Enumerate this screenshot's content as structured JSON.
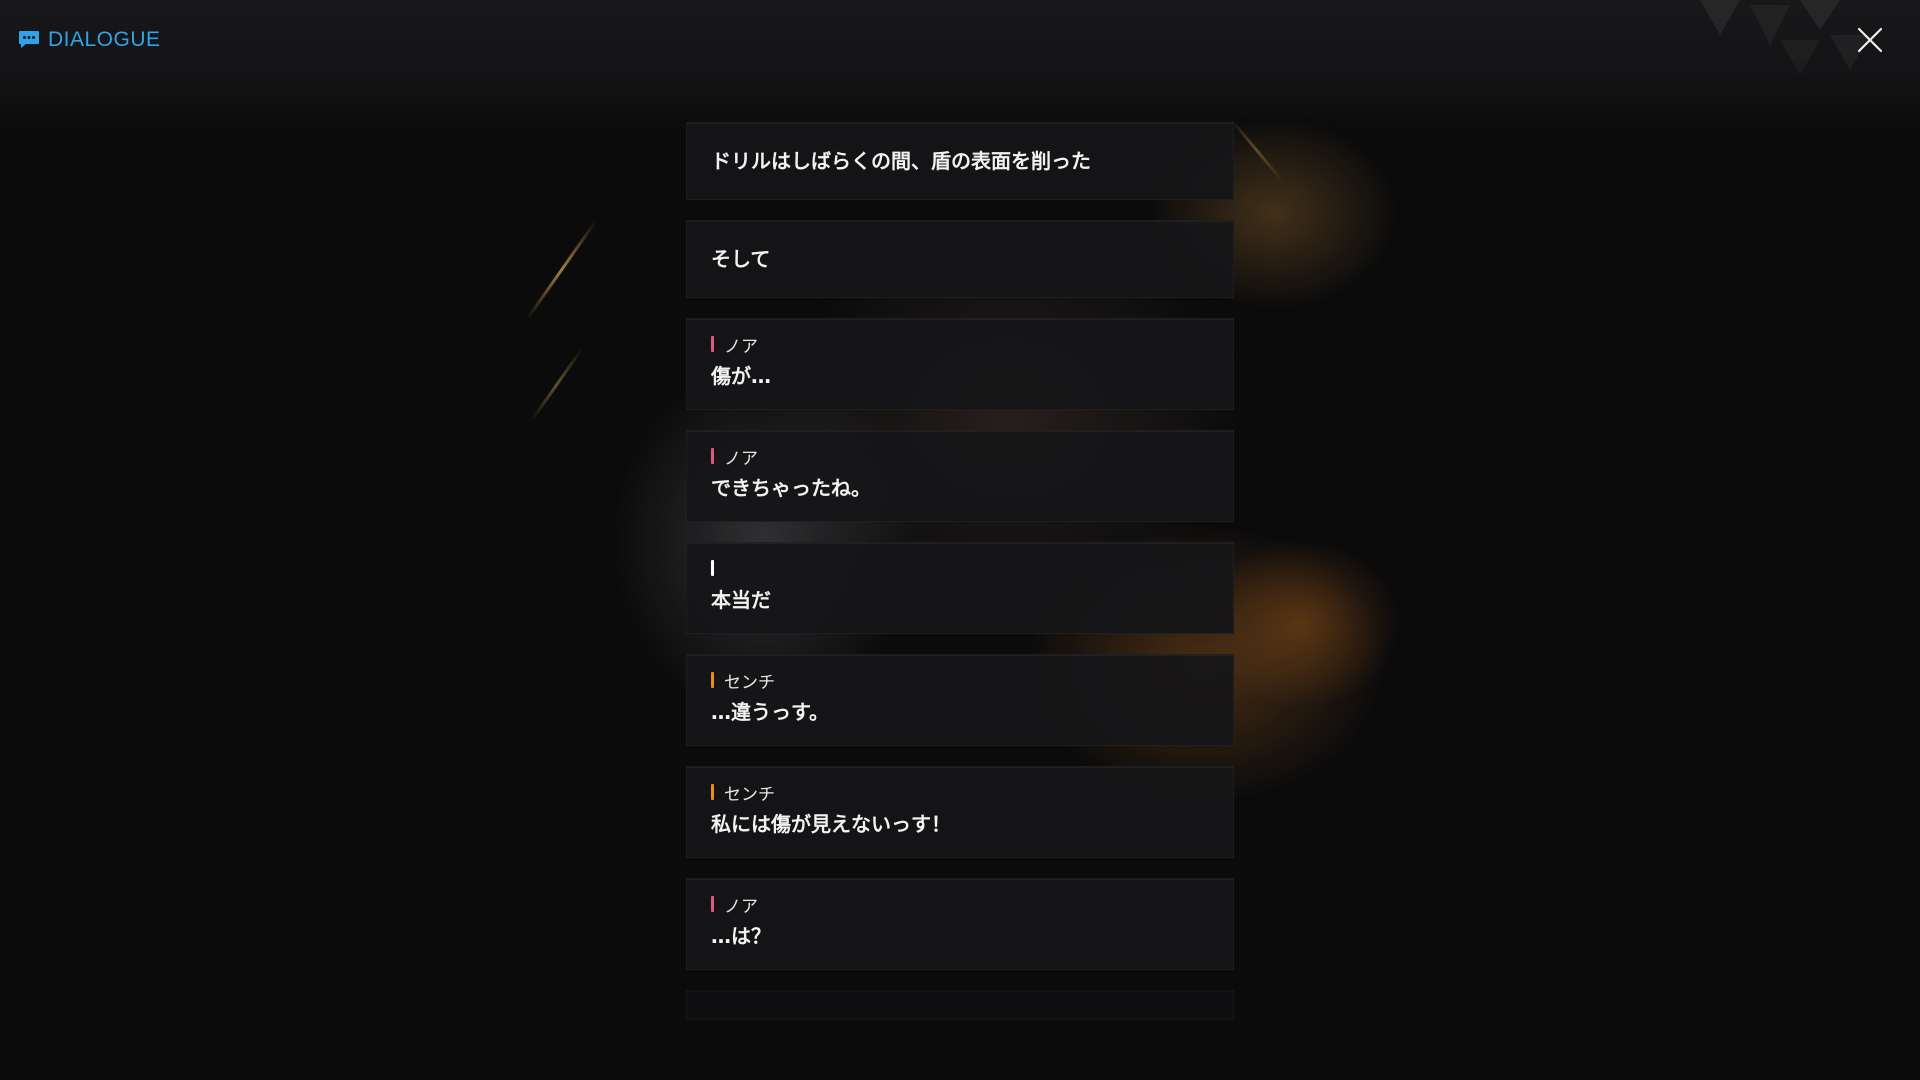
{
  "header": {
    "title": "DIALOGUE",
    "icon": "chat-bubble-icon",
    "accent_color": "#2ea3e8"
  },
  "close_button": {
    "icon": "close-icon"
  },
  "dialogue": [
    {
      "type": "narration",
      "speaker": "",
      "text": "ドリルはしばらくの間、盾の表面を削った"
    },
    {
      "type": "narration",
      "speaker": "",
      "text": "そして"
    },
    {
      "type": "speech",
      "speaker": "ノア",
      "speaker_color": "#e0577f",
      "text": "傷が…"
    },
    {
      "type": "speech",
      "speaker": "ノア",
      "speaker_color": "#e0577f",
      "text": "できちゃったね。"
    },
    {
      "type": "speech",
      "speaker": "",
      "speaker_color": "#ffffff",
      "text": "本当だ"
    },
    {
      "type": "speech",
      "speaker": "センチ",
      "speaker_color": "#f08a1c",
      "text": "…違うっす。"
    },
    {
      "type": "speech",
      "speaker": "センチ",
      "speaker_color": "#f08a1c",
      "text": "私には傷が見えないっす！"
    },
    {
      "type": "speech",
      "speaker": "ノア",
      "speaker_color": "#e0577f",
      "text": "…は？"
    }
  ]
}
